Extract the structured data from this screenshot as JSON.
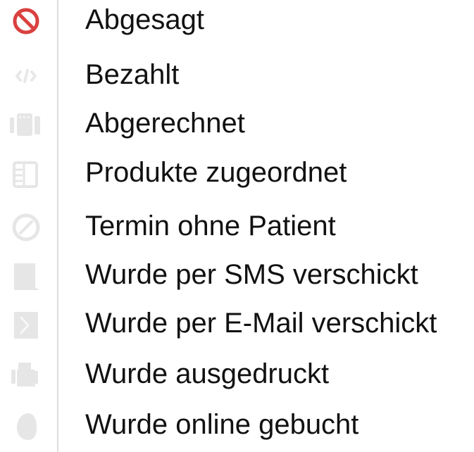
{
  "legend": {
    "items": [
      {
        "label": "Abgesagt",
        "icon": "cancel-icon",
        "icon_color": "#d9413f"
      },
      {
        "label": "Bezahlt",
        "icon": "payment-icon",
        "icon_color": "#e8e8e8"
      },
      {
        "label": "Abgerechnet",
        "icon": "billed-icon",
        "icon_color": "#e6e6e6"
      },
      {
        "label": "Produkte zugeordnet",
        "icon": "products-icon",
        "icon_color": "#e6e6e6"
      },
      {
        "label": "Termin ohne Patient",
        "icon": "no-patient-icon",
        "icon_color": "#e6e6e6"
      },
      {
        "label": "Wurde per SMS verschickt",
        "icon": "sms-icon",
        "icon_color": "#e6e6e6"
      },
      {
        "label": "Wurde per E-Mail verschickt",
        "icon": "email-icon",
        "icon_color": "#e6e6e6"
      },
      {
        "label": "Wurde ausgedruckt",
        "icon": "print-icon",
        "icon_color": "#e6e6e6"
      },
      {
        "label": "Wurde online gebucht",
        "icon": "online-booking-icon",
        "icon_color": "#e6e6e6"
      }
    ]
  }
}
